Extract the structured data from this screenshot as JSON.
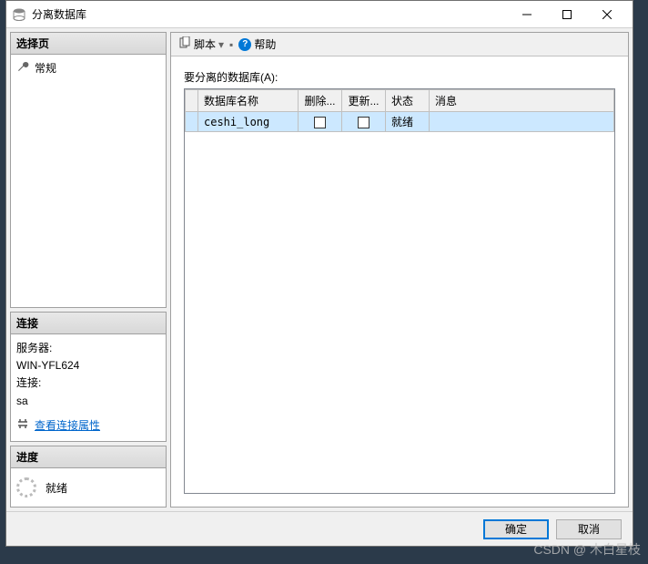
{
  "window": {
    "title": "分离数据库"
  },
  "left": {
    "select_page": {
      "header": "选择页",
      "item": "常规"
    },
    "connection": {
      "header": "连接",
      "server_label": "服务器:",
      "server_value": "WIN-YFL624",
      "conn_label": "连接:",
      "conn_value": "sa",
      "view_props": "查看连接属性"
    },
    "progress": {
      "header": "进度",
      "status": "就绪"
    }
  },
  "toolbar": {
    "script": "脚本",
    "help": "帮助"
  },
  "form": {
    "label": "要分离的数据库(A):",
    "columns": {
      "name": "数据库名称",
      "drop": "删除...",
      "update": "更新...",
      "status": "状态",
      "message": "消息"
    },
    "rows": [
      {
        "name": "ceshi_long",
        "drop": false,
        "update": false,
        "status": "就绪",
        "message": ""
      }
    ]
  },
  "buttons": {
    "ok": "确定",
    "cancel": "取消"
  },
  "watermark": "CSDN @ 木白星枝"
}
